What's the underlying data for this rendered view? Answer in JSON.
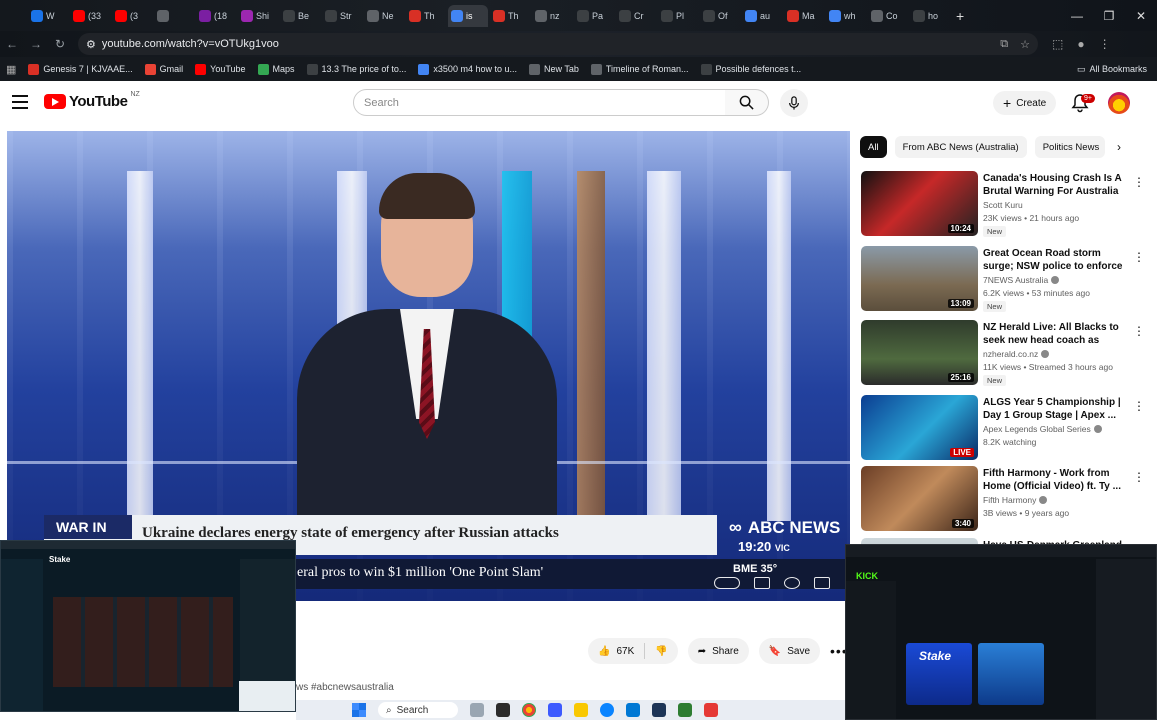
{
  "browser": {
    "tabs": [
      {
        "label": "W",
        "color": "#1a73e8"
      },
      {
        "label": "(33",
        "color": "#ff0000"
      },
      {
        "label": "(3",
        "color": "#ff0000"
      },
      {
        "label": "",
        "color": "#5f6368"
      },
      {
        "label": "(18",
        "color": "#7b1fa2"
      },
      {
        "label": "Shi",
        "color": "#9c27b0"
      },
      {
        "label": "Be",
        "color": "#3c4043"
      },
      {
        "label": "Str",
        "color": "#3c4043"
      },
      {
        "label": "Ne",
        "color": "#5f6368"
      },
      {
        "label": "Th",
        "color": "#d93025"
      },
      {
        "label": "is",
        "color": "#4285f4"
      },
      {
        "label": "Th",
        "color": "#d93025"
      },
      {
        "label": "nz",
        "color": "#5f6368"
      },
      {
        "label": "Pa",
        "color": "#3c4043"
      },
      {
        "label": "Cr",
        "color": "#3c4043"
      },
      {
        "label": "Pl",
        "color": "#3c4043"
      },
      {
        "label": "Of",
        "color": "#3c4043"
      },
      {
        "label": "au",
        "color": "#4285f4"
      },
      {
        "label": "Ma",
        "color": "#d93025"
      },
      {
        "label": "wh",
        "color": "#4285f4"
      },
      {
        "label": "Co",
        "color": "#5f6368"
      },
      {
        "label": "ho",
        "color": "#3c4043"
      }
    ],
    "window_controls": {
      "minimize": "—",
      "restore": "❐",
      "close": "✕"
    },
    "url": "youtube.com/watch?v=vOTUkg1voo",
    "bookmarks": [
      {
        "label": "Genesis 7 | KJVAAE...",
        "color": "#d93025"
      },
      {
        "label": "Gmail",
        "color": "#ea4335"
      },
      {
        "label": "YouTube",
        "color": "#ff0000"
      },
      {
        "label": "Maps",
        "color": "#34a853"
      },
      {
        "label": "13.3 The price of to...",
        "color": "#3c4043"
      },
      {
        "label": "x3500 m4 how to u...",
        "color": "#4285f4"
      },
      {
        "label": "New Tab",
        "color": "#5f6368"
      },
      {
        "label": "Timeline of Roman...",
        "color": "#5f6368"
      },
      {
        "label": "Possible defences t...",
        "color": "#3c4043"
      }
    ],
    "all_bookmarks": "All Bookmarks"
  },
  "youtube": {
    "logo_text": "YouTube",
    "country": "NZ",
    "search_placeholder": "Search",
    "create_label": "Create",
    "notification_count": "9+"
  },
  "player": {
    "banner_tag": "WAR IN",
    "headline": "Ukraine declares energy state of emergency after Russian attacks",
    "network": "ABC NEWS",
    "time": "19:20",
    "time_zone": "VIC",
    "ticker": "eral pros to win $1 million 'One Point Slam'",
    "weather": "BME 35°"
  },
  "actions": {
    "likes": "67K",
    "share": "Share",
    "save": "Save",
    "more": "•••",
    "hashtags": "ws #abcnewsaustralia"
  },
  "chips": [
    "All",
    "From ABC News (Australia)",
    "Politics News"
  ],
  "recommendations": [
    {
      "title": "Canada's Housing Crash Is A Brutal Warning For Australia ...",
      "channel": "Scott Kuru",
      "verified": false,
      "meta": "23K views • 21 hours ago",
      "badge": "New",
      "duration": "10:24",
      "live": false,
      "thumb": "linear-gradient(135deg,#111 0%,#c62828 45%,#222 100%)"
    },
    {
      "title": "Great Ocean Road storm surge; NSW police to enforce protest ...",
      "channel": "7NEWS Australia",
      "verified": true,
      "meta": "6.2K views • 53 minutes ago",
      "badge": "New",
      "duration": "13:09",
      "live": false,
      "thumb": "linear-gradient(180deg,#8a9aa8 0%,#7b6a52 60%,#5b4e3c 100%)"
    },
    {
      "title": "NZ Herald Live: All Blacks to seek new head coach as Scott...",
      "channel": "nzherald.co.nz",
      "verified": true,
      "meta": "11K views • Streamed 3 hours ago",
      "badge": "New",
      "duration": "25:16",
      "live": false,
      "thumb": "linear-gradient(180deg,#2f3b2c 0%,#4f6a3f 60%,#2b2b2b 100%)"
    },
    {
      "title": "ALGS Year 5 Championship | Day 1 Group Stage | Apex ...",
      "channel": "Apex Legends Global Series",
      "verified": true,
      "meta": "8.2K watching",
      "badge": "",
      "duration": "LIVE",
      "live": true,
      "thumb": "linear-gradient(135deg,#0b3d91 0%,#2aa6d6 55%,#0a2a66 100%)"
    },
    {
      "title": "Fifth Harmony - Work from Home (Official Video) ft. Ty ...",
      "channel": "Fifth Harmony",
      "verified": true,
      "meta": "3B views • 9 years ago",
      "badge": "",
      "duration": "3:40",
      "live": false,
      "thumb": "linear-gradient(135deg,#6b3e26 0%,#c08a5b 50%,#3b2418 100%)"
    },
    {
      "title": "Have US-Denmark Greenland",
      "channel": "",
      "verified": false,
      "meta": "",
      "badge": "",
      "duration": "",
      "live": false,
      "thumb": "linear-gradient(180deg,#cfd8dc 0%,#90a4ae 100%)"
    }
  ],
  "overlays": {
    "left_brand": "Stake",
    "right_brand": "KICK",
    "right_promo": "Stake"
  },
  "taskbar": {
    "search": "Search"
  }
}
